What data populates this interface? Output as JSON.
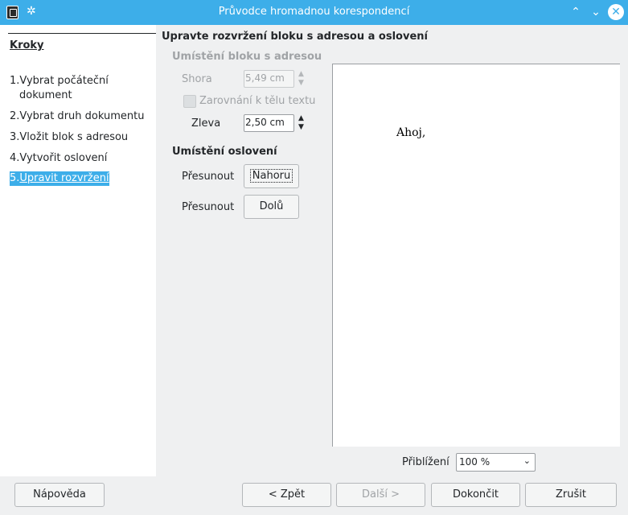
{
  "window": {
    "title": "Průvodce hromadnou korespondencí"
  },
  "steps": {
    "heading": "Kroky",
    "items": [
      {
        "num": "1.",
        "line1": "Vybrat počáteční",
        "line2": "dokument"
      },
      {
        "num": "2.",
        "line1": "Vybrat druh dokumentu"
      },
      {
        "num": "3.",
        "line1": "Vložit blok s adresou"
      },
      {
        "num": "4.",
        "line1": "Vytvořit oslovení"
      },
      {
        "num": "5.",
        "line1": "Upravit rozvržení"
      }
    ],
    "active_index": 4
  },
  "main": {
    "title": "Upravte rozvržení bloku s adresou a oslovení",
    "address_section": {
      "title": "Umístění bloku s adresou",
      "top_label": "Shora",
      "top_value": "5,49 cm",
      "align_label": "Zarovnání k tělu textu",
      "align_checked": false,
      "left_label": "Zleva",
      "left_value": "2,50 cm"
    },
    "salutation_section": {
      "title": "Umístění oslovení",
      "move_label_1": "Přesunout",
      "up_button": "Nahoru",
      "move_label_2": "Přesunout",
      "down_button": "Dolů"
    },
    "preview": {
      "greeting": "Ahoj,"
    },
    "zoom": {
      "label": "Přiblížení",
      "value": "100 %"
    }
  },
  "footer": {
    "help": "Nápověda",
    "back": "< Zpět",
    "next": "Další >",
    "finish": "Dokončit",
    "cancel": "Zrušit"
  }
}
